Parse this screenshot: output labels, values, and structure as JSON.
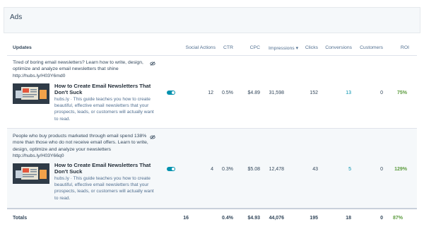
{
  "header": {
    "title": "Ads"
  },
  "columns": {
    "updates": "Updates",
    "social_actions": "Social Actions",
    "ctr": "CTR",
    "cpc": "CPC",
    "impressions": "Impressions ▾",
    "clicks": "Clicks",
    "conversions": "Conversions",
    "customers": "Customers",
    "roi": "ROI"
  },
  "rows": [
    {
      "text": "Tired of boring email newsletters? Learn how to write, design, optimize and analyze email newsletters that shine http://hubs.ly/H03Y6md0",
      "card_title": "How to Create Email Newsletters That Don't Suck",
      "card_domain": "hubs.ly",
      "card_desc": "This guide teaches you how to create beautiful, effective email newsletters that your prospects, leads, or customers will actually want to read.",
      "social_actions": "12",
      "ctr": "0.5%",
      "cpc": "$4.89",
      "impressions": "31,598",
      "clicks": "152",
      "conversions": "13",
      "customers": "0",
      "roi": "75%"
    },
    {
      "text": "People who buy products marketed through email spend 138% more than those who do not receive email offers. Learn to write, design, optimize and analyze your newsletters http://hubs.ly/H03Y66q0",
      "card_title": "How to Create Email Newsletters That Don't Suck",
      "card_domain": "hubs.ly",
      "card_desc": "This guide teaches you how to create beautiful, effective email newsletters that your prospects, leads, or customers will actually want to read.",
      "social_actions": "4",
      "ctr": "0.3%",
      "cpc": "$5.08",
      "impressions": "12,478",
      "clicks": "43",
      "conversions": "5",
      "customers": "0",
      "roi": "129%"
    }
  ],
  "totals": {
    "label": "Totals",
    "social_actions": "16",
    "ctr": "0.4%",
    "cpc": "$4.93",
    "impressions": "44,076",
    "clicks": "195",
    "conversions": "18",
    "customers": "0",
    "roi": "87%"
  },
  "colors": {
    "accent": "#0091ae",
    "roi_green": "#5d9c3f",
    "header_bg": "#f5f8fa"
  },
  "icons": {
    "visibility": "eye-slash-icon",
    "toggle": "toggle-switch"
  }
}
